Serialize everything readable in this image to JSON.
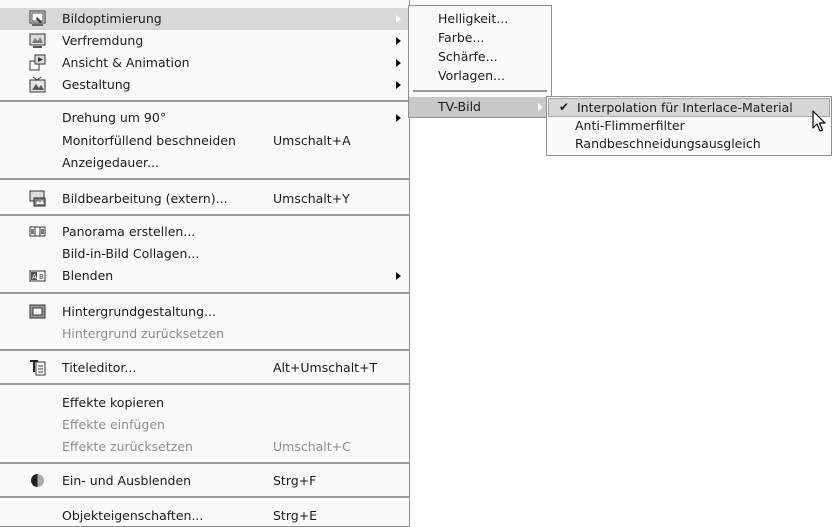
{
  "main_menu": {
    "items": [
      {
        "label": "Bildoptimierung",
        "icon": "image-optimize-icon"
      },
      {
        "label": "Verfremdung",
        "icon": "alienation-icon"
      },
      {
        "label": "Ansicht & Animation",
        "icon": "animation-icon"
      },
      {
        "label": "Gestaltung",
        "icon": "design-icon"
      },
      {
        "label": "Drehung um 90°"
      },
      {
        "label": "Monitorfüllend beschneiden",
        "shortcut": "Umschalt+A"
      },
      {
        "label": "Anzeigedauer..."
      },
      {
        "label": "Bildbearbeitung (extern)...",
        "shortcut": "Umschalt+Y",
        "icon": "external-edit-icon"
      },
      {
        "label": "Panorama erstellen...",
        "icon": "panorama-icon"
      },
      {
        "label": "Bild-in-Bild Collagen..."
      },
      {
        "label": "Blenden",
        "icon": "blend-icon"
      },
      {
        "label": "Hintergrundgestaltung...",
        "icon": "background-icon"
      },
      {
        "label": "Hintergrund zurücksetzen"
      },
      {
        "label": "Titeleditor...",
        "shortcut": "Alt+Umschalt+T",
        "icon": "title-editor-icon"
      },
      {
        "label": "Effekte kopieren"
      },
      {
        "label": "Effekte einfügen"
      },
      {
        "label": "Effekte zurücksetzen",
        "shortcut": "Umschalt+C"
      },
      {
        "label": "Ein- und Ausblenden",
        "shortcut": "Strg+F",
        "icon": "fade-icon"
      },
      {
        "label": "Objekteigenschaften...",
        "shortcut": "Strg+E"
      }
    ]
  },
  "submenu_bildoptimierung": {
    "items": [
      {
        "label": "Helligkeit..."
      },
      {
        "label": "Farbe..."
      },
      {
        "label": "Schärfe..."
      },
      {
        "label": "Vorlagen..."
      },
      {
        "label": "TV-Bild"
      }
    ]
  },
  "submenu_tvbild": {
    "items": [
      {
        "label": "Interpolation für Interlace-Material",
        "checked": true
      },
      {
        "label": "Anti-Flimmerfilter"
      },
      {
        "label": "Randbeschneidungsausgleich"
      }
    ],
    "check_glyph": "✔"
  },
  "colors": {
    "highlight": "#d8d8d8",
    "disabled_text": "#8c8c8c",
    "separator": "#9a9a9a"
  }
}
